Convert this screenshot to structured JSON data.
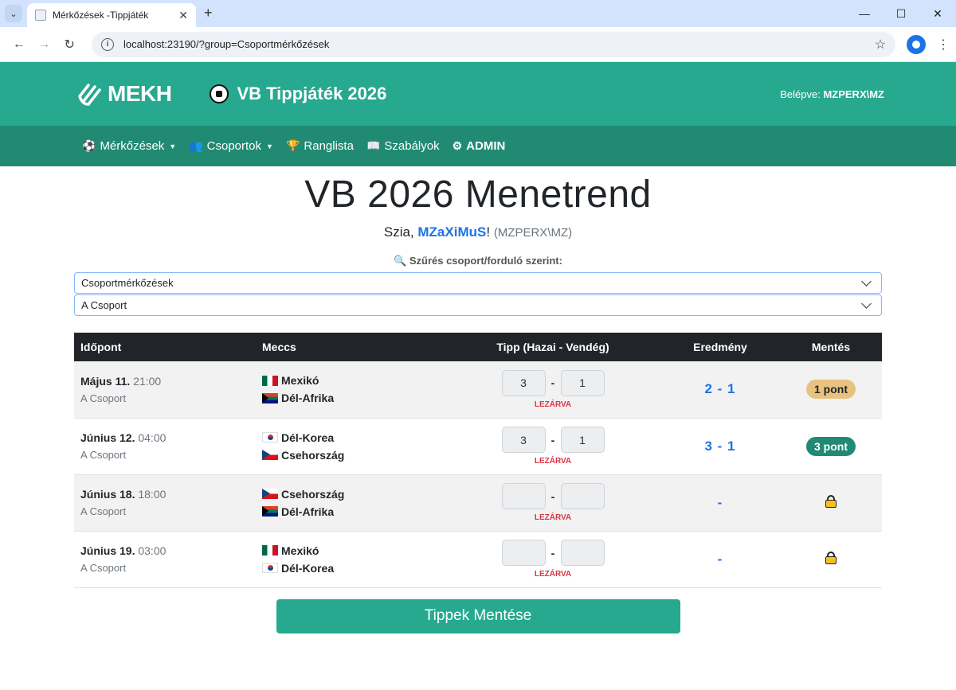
{
  "browser": {
    "tab_title": "Mérkőzések -Tippjáték",
    "url": "localhost:23190/?group=Csoportmérkőzések"
  },
  "header": {
    "logo_text": "MEKH",
    "app_title": "VB Tippjáték 2026",
    "login_label": "Belépve:",
    "login_user": "MZPERX\\MZ"
  },
  "nav": {
    "matches": "Mérkőzések",
    "groups": "Csoportok",
    "ranking": "Ranglista",
    "rules": "Szabályok",
    "admin": "ADMIN"
  },
  "main": {
    "title": "VB 2026 Menetrend",
    "greeting_prefix": "Szia,",
    "nickname": "MZaXiMuS",
    "greeting_suffix": "!",
    "user_id": "(MZPERX\\MZ)",
    "filter_label": "Szűrés csoport/forduló szerint:",
    "stage_select": "Csoportmérkőzések",
    "group_select": "A Csoport",
    "save_button": "Tippek Mentése"
  },
  "table": {
    "headers": {
      "time": "Időpont",
      "match": "Meccs",
      "tip": "Tipp (Hazai - Vendég)",
      "result": "Eredmény",
      "save": "Mentés"
    },
    "rows": [
      {
        "date": "Május 11.",
        "time": "21:00",
        "group": "A Csoport",
        "home": "Mexikó",
        "away": "Dél-Afrika",
        "home_flag": "mx",
        "away_flag": "za",
        "tip_home": "3",
        "tip_away": "1",
        "locked": "LEZÁRVA",
        "result": "2 - 1",
        "points": "1 pont"
      },
      {
        "date": "Június 12.",
        "time": "04:00",
        "group": "A Csoport",
        "home": "Dél-Korea",
        "away": "Csehország",
        "home_flag": "kr",
        "away_flag": "cz",
        "tip_home": "3",
        "tip_away": "1",
        "locked": "LEZÁRVA",
        "result": "3 - 1",
        "points": "3 pont"
      },
      {
        "date": "Június 18.",
        "time": "18:00",
        "group": "A Csoport",
        "home": "Csehország",
        "away": "Dél-Afrika",
        "home_flag": "cz",
        "away_flag": "za",
        "tip_home": "",
        "tip_away": "",
        "locked": "LEZÁRVA",
        "result": "-",
        "points": ""
      },
      {
        "date": "Június 19.",
        "time": "03:00",
        "group": "A Csoport",
        "home": "Mexikó",
        "away": "Dél-Korea",
        "home_flag": "mx",
        "away_flag": "kr",
        "tip_home": "",
        "tip_away": "",
        "locked": "LEZÁRVA",
        "result": "-",
        "points": ""
      }
    ]
  }
}
